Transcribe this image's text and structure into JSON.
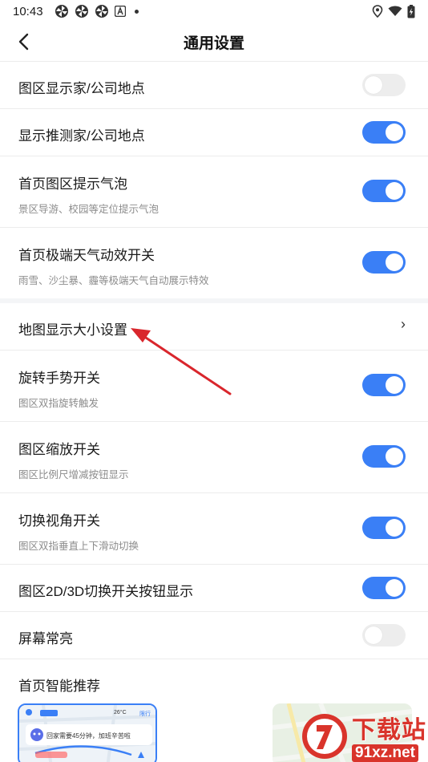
{
  "status_bar": {
    "time": "10:43",
    "left_icons": [
      "pinwheel-icon",
      "pinwheel-icon",
      "pinwheel-icon",
      "app-a-icon",
      "dot-icon"
    ],
    "right_icons": [
      "location-icon",
      "wifi-icon",
      "battery-charging-icon"
    ]
  },
  "header": {
    "title": "通用设置",
    "back_icon": "chevron-left-icon"
  },
  "settings": [
    {
      "label": "图区显示家/公司地点",
      "toggle": "off"
    },
    {
      "label": "显示推测家/公司地点",
      "toggle": "on"
    },
    {
      "label": "首页图区提示气泡",
      "sub": "景区导游、校园等定位提示气泡",
      "toggle": "on"
    },
    {
      "label": "首页极端天气动效开关",
      "sub": "雨雪、沙尘暴、霾等极端天气自动展示特效",
      "toggle": "on"
    },
    {
      "label": "地图显示大小设置",
      "chevron": "›"
    },
    {
      "label": "旋转手势开关",
      "sub": "图区双指旋转触发",
      "toggle": "on"
    },
    {
      "label": "图区缩放开关",
      "sub": "图区比例尺增减按钮显示",
      "toggle": "on"
    },
    {
      "label": "切换视角开关",
      "sub": "图区双指垂直上下滑动切换",
      "toggle": "on"
    },
    {
      "label": "图区2D/3D切换开关按钮显示",
      "toggle": "on"
    },
    {
      "label": "屏幕常亮",
      "toggle": "off"
    },
    {
      "label": "首页智能推荐"
    }
  ],
  "thumbnail_left": {
    "temperature": "26°C",
    "weather": "限行",
    "tip": "回家需要45分钟，加班辛苦啦"
  },
  "watermark": {
    "big": "下载站",
    "small": "91xz.net"
  },
  "colors": {
    "accent": "#3a7ff6",
    "toggle_off": "#ededed",
    "annotation_arrow": "#d9262c"
  }
}
